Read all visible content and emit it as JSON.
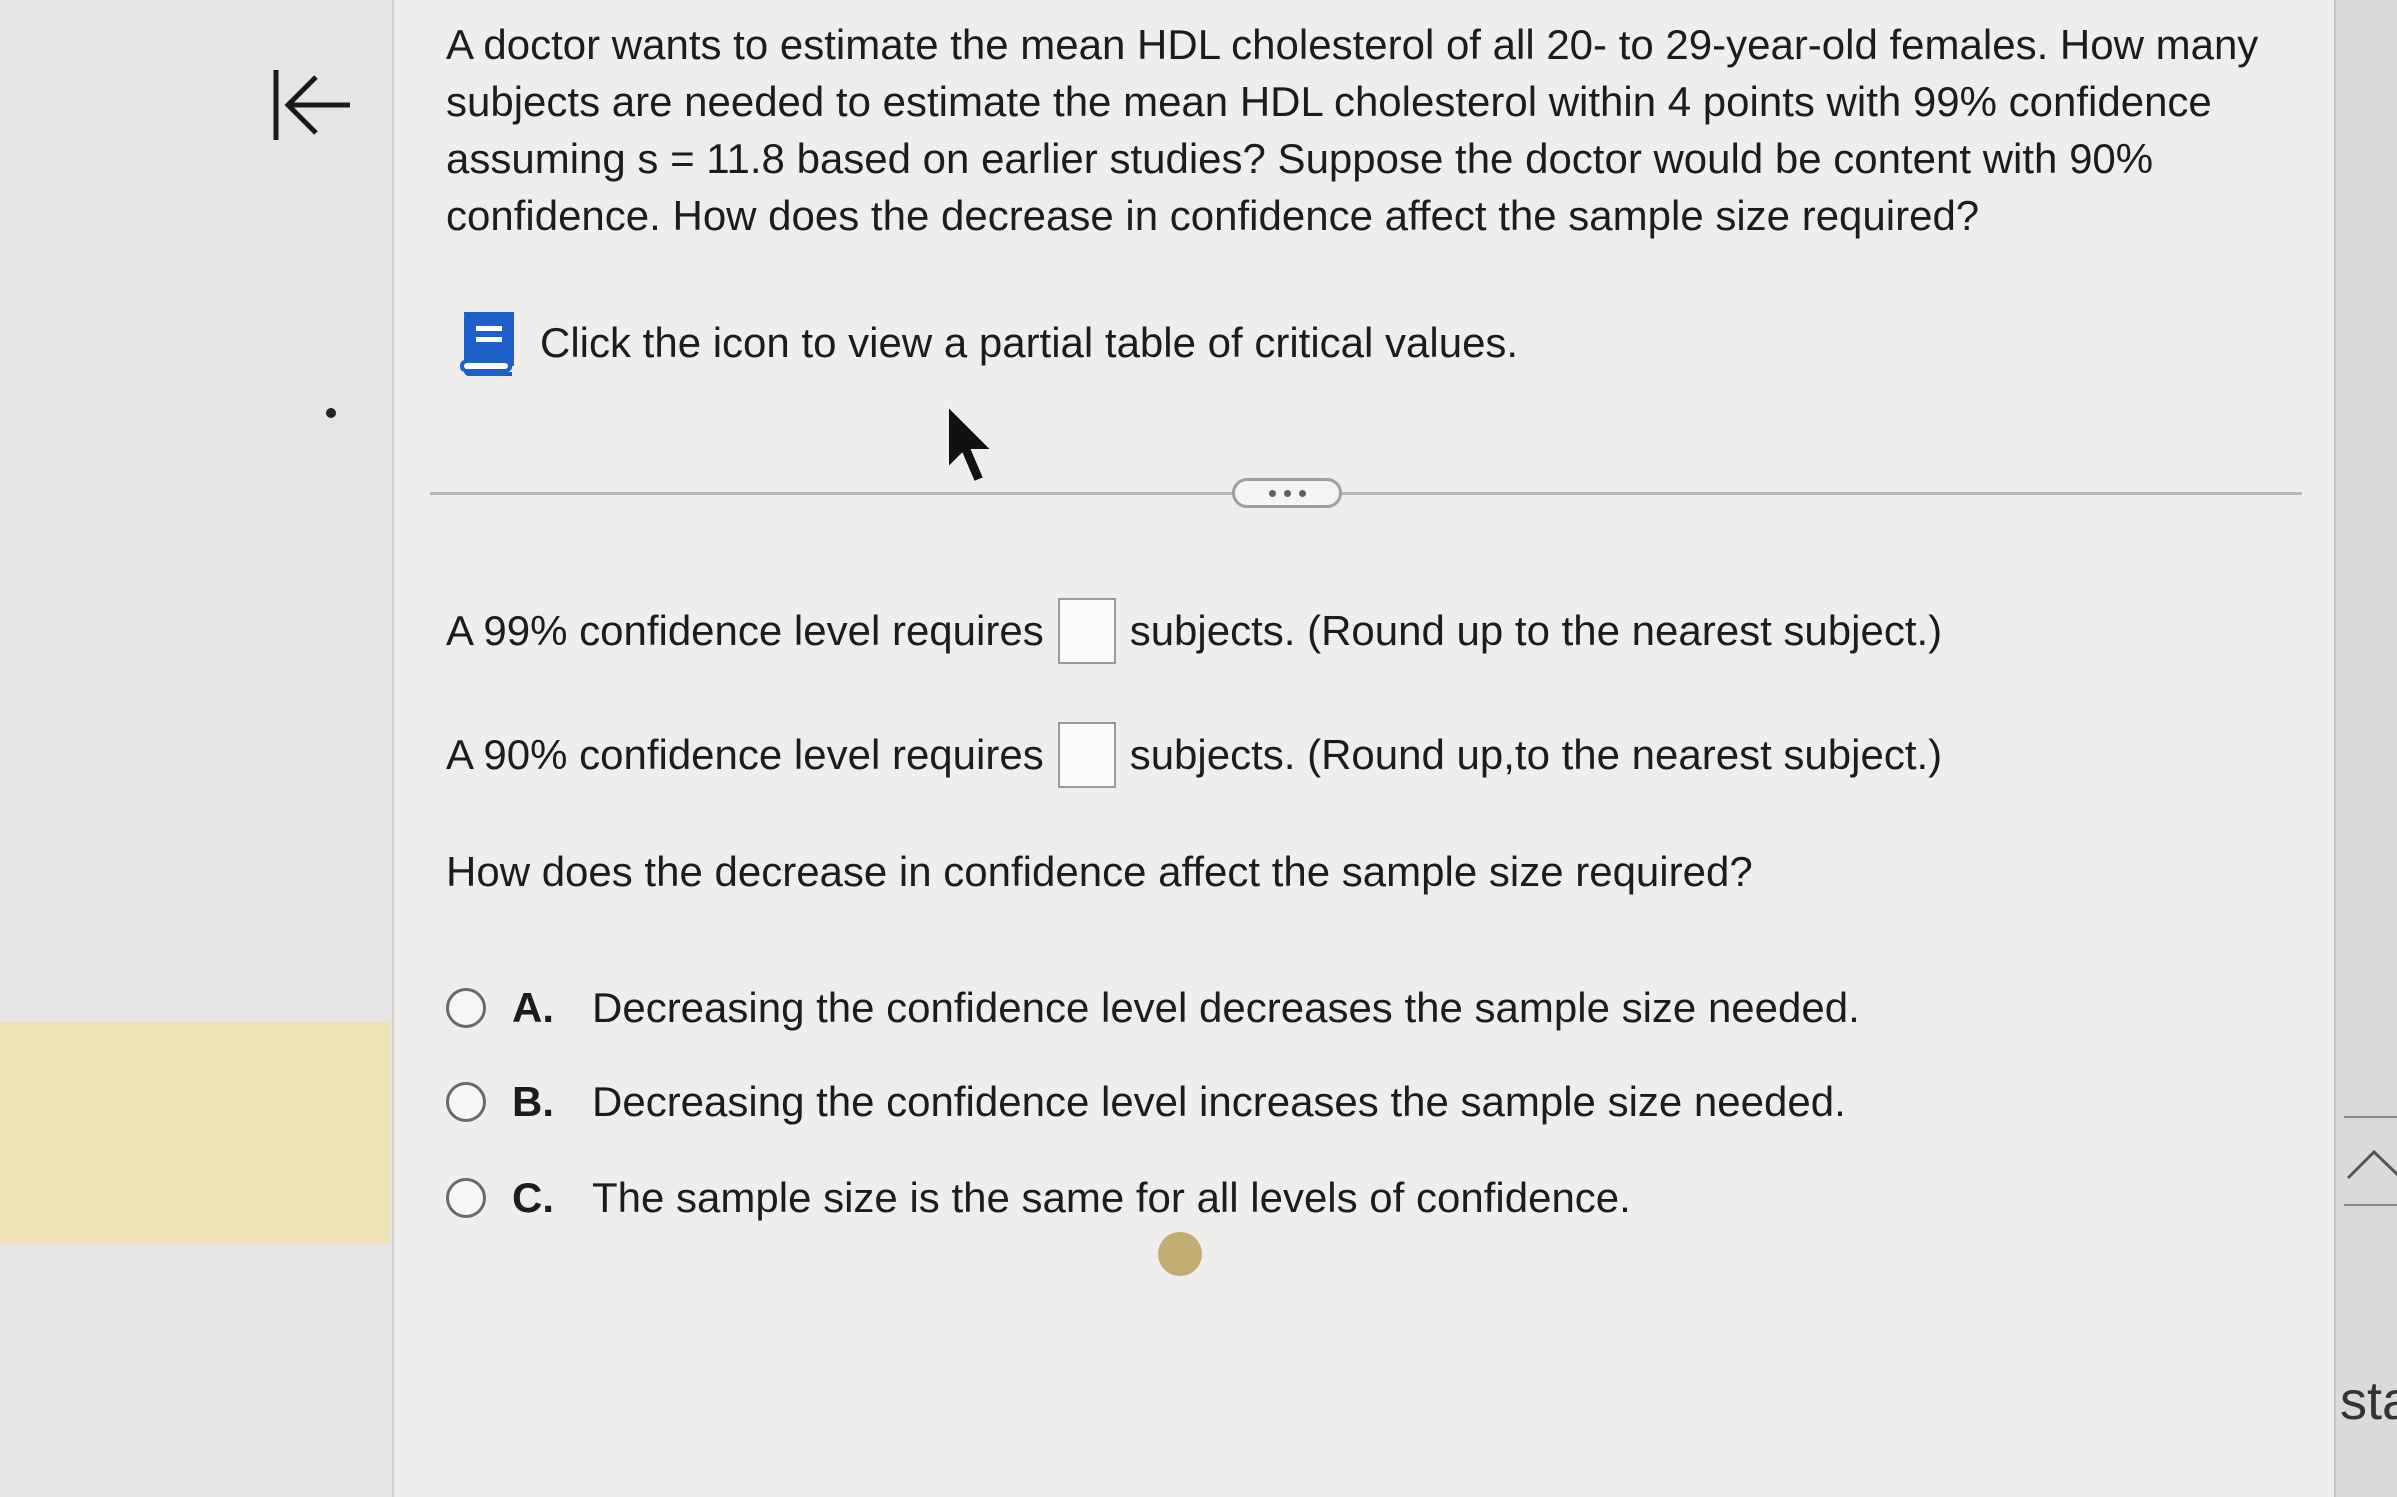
{
  "nav": {
    "back_icon": "collapse-left-arrow-icon"
  },
  "question": {
    "paragraph": "A doctor wants to estimate the mean HDL cholesterol of all 20- to 29-year-old females. How many subjects are needed to estimate the mean HDL cholesterol within 4 points with 99% confidence assuming s = 11.8 based on earlier studies? Suppose the doctor would be content with 90% confidence. How does the decrease in confidence affect the sample size required?"
  },
  "table_link": {
    "icon": "book-icon",
    "text": "Click the icon to view a partial table of critical values."
  },
  "answers": {
    "row1_prefix": "A 99% confidence level requires",
    "row1_suffix": "subjects. (Round up to the nearest subject.)",
    "row1_value": "",
    "row2_prefix": "A 90% confidence level requires",
    "row2_suffix": "subjects. (Round up,to the nearest subject.)",
    "row2_value": ""
  },
  "prompt": "How does the decrease in confidence affect the sample size required?",
  "options": [
    {
      "letter": "A.",
      "text": "Decreasing the confidence level decreases the sample size needed."
    },
    {
      "letter": "B.",
      "text": "Decreasing the confidence level increases the sample size needed."
    },
    {
      "letter": "C.",
      "text": "The sample size is the same for all levels of confidence."
    }
  ],
  "right_edge": {
    "text": "sta"
  },
  "colors": {
    "accent_blue": "#1f5fc9",
    "highlight": "#ece2b6"
  }
}
